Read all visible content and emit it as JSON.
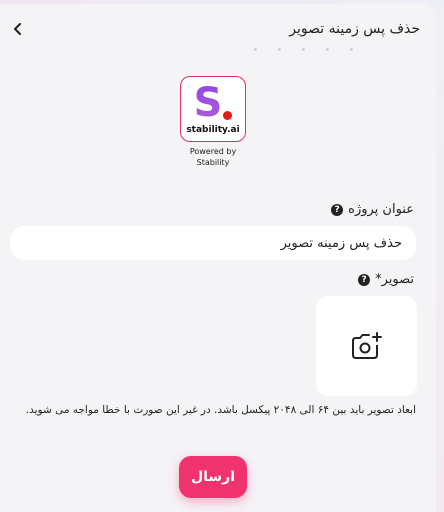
{
  "header": {
    "title": "حذف پس زمینه تصویر",
    "back_icon": "chevron-left-icon"
  },
  "logo": {
    "letter": "S",
    "wordmark": "stability.ai",
    "powered_line1": "Powered by",
    "powered_line2": "Stability",
    "border_color": "#e0306a",
    "dot_color": "#e41b1b"
  },
  "form": {
    "project_title_label": "عنوان پروژه",
    "project_title_value": "حذف پس زمینه تصویر",
    "image_label": "تصویر*",
    "upload_icon": "camera-add-icon",
    "image_note": "ابعاد تصویر باید بین ۶۴ الی ۲۰۴۸ پیکسل باشد. در غیر این صورت با خطا مواجه می شوید."
  },
  "actions": {
    "submit_label": "ارسال",
    "submit_color": "#f0336e"
  }
}
